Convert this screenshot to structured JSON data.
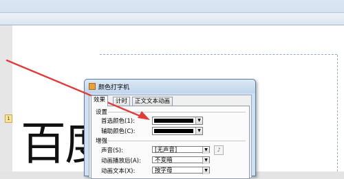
{
  "annotation": {
    "animation_tag": "1",
    "slide_text": "百度"
  },
  "dialog": {
    "title": "颜色打字机",
    "tabs": [
      "效果",
      "计时",
      "正文文本动画"
    ],
    "settings_group": "设置",
    "primary_color_label": "首选颜色(1):",
    "secondary_color_label": "辅助颜色(C):",
    "primary_color": "#000000",
    "secondary_color": "#000000",
    "enhance_group": "增强",
    "sound_label": "声音(S):",
    "sound_value": "[无声音]",
    "after_anim_label": "动画播放后(A):",
    "after_anim_value": "不变暗",
    "anim_text_label": "动画文本(X):",
    "anim_text_value": "按字母"
  },
  "colors": {
    "arrow": "#e03c3c",
    "dialog_border": "#5a7ea8"
  }
}
